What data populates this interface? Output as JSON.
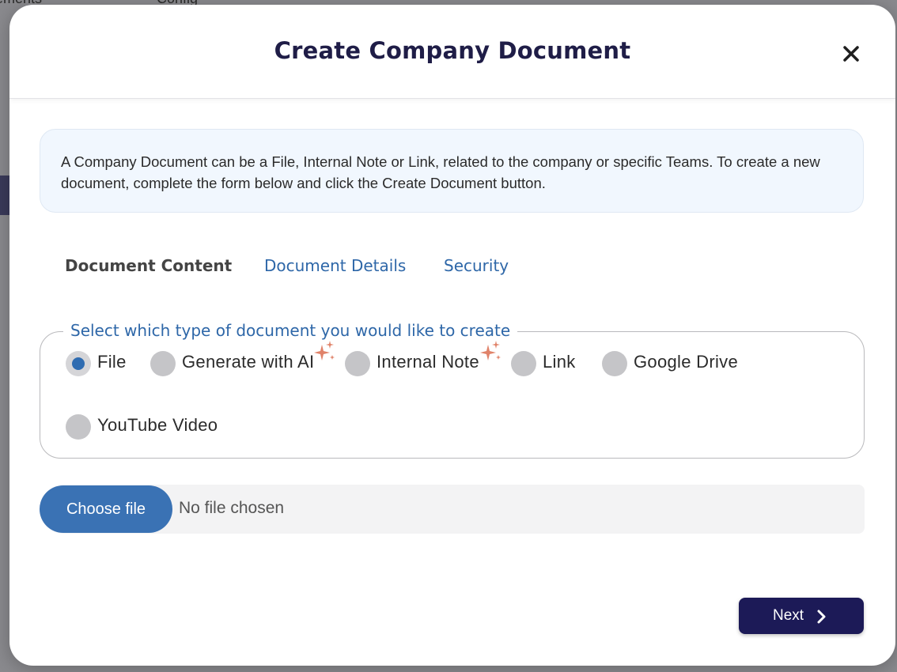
{
  "background": {
    "partial_texts": [
      "ements",
      "Config"
    ]
  },
  "modal": {
    "title": "Create Company Document",
    "close_icon": "close-icon",
    "info_text": "A Company Document can be a File, Internal Note or Link, related to the company or specific Teams. To create a new document, complete the form below and click the Create Document button.",
    "tabs": [
      {
        "label": "Document Content",
        "active": true
      },
      {
        "label": "Document Details",
        "active": false
      },
      {
        "label": "Security",
        "active": false
      }
    ],
    "doc_type": {
      "legend": "Select which type of document you would like to create",
      "options": [
        {
          "label": "File",
          "checked": true,
          "ai": false
        },
        {
          "label": "Generate with AI",
          "checked": false,
          "ai": true
        },
        {
          "label": "Internal Note",
          "checked": false,
          "ai": true
        },
        {
          "label": "Link",
          "checked": false,
          "ai": false
        },
        {
          "label": "Google Drive",
          "checked": false,
          "ai": false
        },
        {
          "label": "YouTube Video",
          "checked": false,
          "ai": false
        }
      ]
    },
    "file_input": {
      "button_label": "Choose file",
      "status": "No file chosen"
    },
    "next_button": {
      "label": "Next",
      "icon": "chevron-right-icon"
    },
    "colors": {
      "title": "#1f1d47",
      "accent": "#2e67a8",
      "primary_button": "#1c1a57",
      "choose_button": "#3a72b4",
      "sparkle": "#e0836a"
    }
  }
}
